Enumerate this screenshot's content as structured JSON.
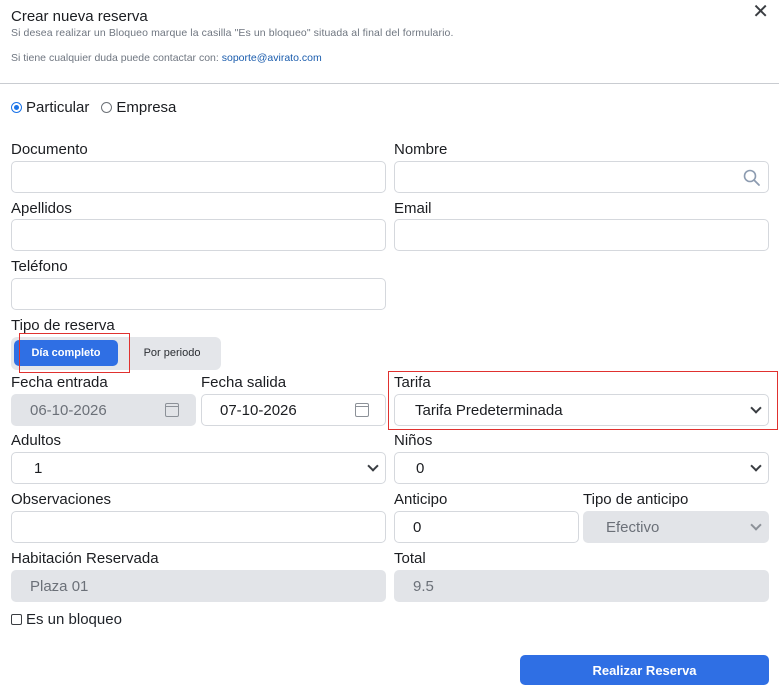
{
  "modal": {
    "title": "Crear nueva reserva",
    "subtitle": "Si desea realizar un Bloqueo marque la casilla \"Es un bloqueo\" situada al final del formulario.",
    "contact_text": "Si tiene cualquier duda puede contactar con:",
    "contact_email": "soporte@avirato.com",
    "close_symbol": "✕"
  },
  "client_type": {
    "options": [
      "Particular",
      "Empresa"
    ],
    "selected": "Particular"
  },
  "fields": {
    "documento": {
      "label": "Documento",
      "value": ""
    },
    "nombre": {
      "label": "Nombre",
      "value": ""
    },
    "apellidos": {
      "label": "Apellidos",
      "value": ""
    },
    "email": {
      "label": "Email",
      "value": ""
    },
    "telefono": {
      "label": "Teléfono",
      "value": ""
    },
    "fecha_entrada": {
      "label": "Fecha entrada",
      "value": "06-10-2026"
    },
    "fecha_salida": {
      "label": "Fecha salida",
      "value": "07-10-2026"
    },
    "tarifa": {
      "label": "Tarifa",
      "value": "Tarifa Predeterminada"
    },
    "adultos": {
      "label": "Adultos",
      "value": "1"
    },
    "ninos": {
      "label": "Niños",
      "value": "0"
    },
    "observaciones": {
      "label": "Observaciones",
      "value": ""
    },
    "anticipo": {
      "label": "Anticipo",
      "value": "0"
    },
    "tipo_anticipo": {
      "label": "Tipo de anticipo",
      "value": "Efectivo"
    },
    "habitacion": {
      "label": "Habitación Reservada",
      "value": "Plaza 01"
    },
    "total": {
      "label": "Total",
      "value": "9.5"
    }
  },
  "booking_type": {
    "label": "Tipo de reserva",
    "options": [
      "Día completo",
      "Por periodo"
    ],
    "selected": "Día completo"
  },
  "block": {
    "label": "Es un bloqueo",
    "checked": false
  },
  "actions": {
    "submit_label": "Realizar Reserva"
  },
  "colors": {
    "accent": "#2f6fe4",
    "highlight": "#e0312f",
    "disabled_bg": "#e2e4e8"
  },
  "icons": {
    "search": "search-icon",
    "calendar": "calendar-icon",
    "dropdown": "chevron-down-icon",
    "close": "close-icon"
  }
}
